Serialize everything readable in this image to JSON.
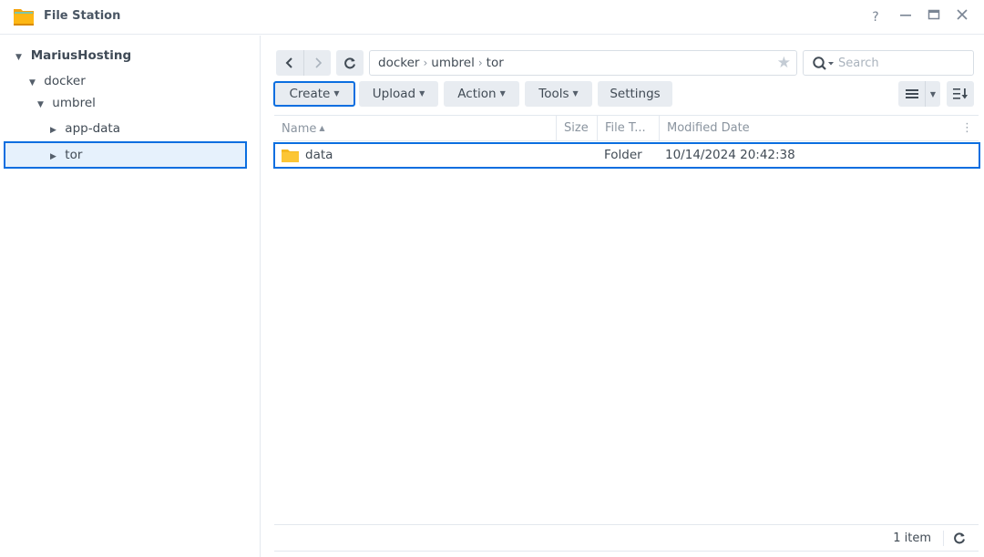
{
  "window": {
    "title": "File Station",
    "help_label": "?",
    "minimize_label": "—",
    "close_label": "✕"
  },
  "sidebar": {
    "root": "MariusHosting",
    "items": [
      {
        "label": "docker",
        "expanded": true
      },
      {
        "label": "umbrel",
        "expanded": true
      },
      {
        "label": "app-data",
        "expanded": false
      },
      {
        "label": "tor",
        "expanded": false,
        "selected": true
      }
    ]
  },
  "navigation": {
    "path": [
      "docker",
      "umbrel",
      "tor"
    ],
    "path_separator": "›",
    "search_placeholder": "Search"
  },
  "toolbar": {
    "create_label": "Create",
    "upload_label": "Upload",
    "action_label": "Action",
    "tools_label": "Tools",
    "settings_label": "Settings"
  },
  "grid": {
    "columns": {
      "name": "Name",
      "size": "Size",
      "file_type": "File T...",
      "modified": "Modified Date"
    },
    "rows": [
      {
        "name": "data",
        "size": "",
        "type": "Folder",
        "modified": "10/14/2024 20:42:38",
        "selected": true
      }
    ]
  },
  "footer": {
    "item_count": "1 item"
  },
  "colors": {
    "accent": "#0a6ee0",
    "selected_bg": "#e6f1fc",
    "button_bg": "#e8ecf1",
    "folder": "#fbc531"
  }
}
